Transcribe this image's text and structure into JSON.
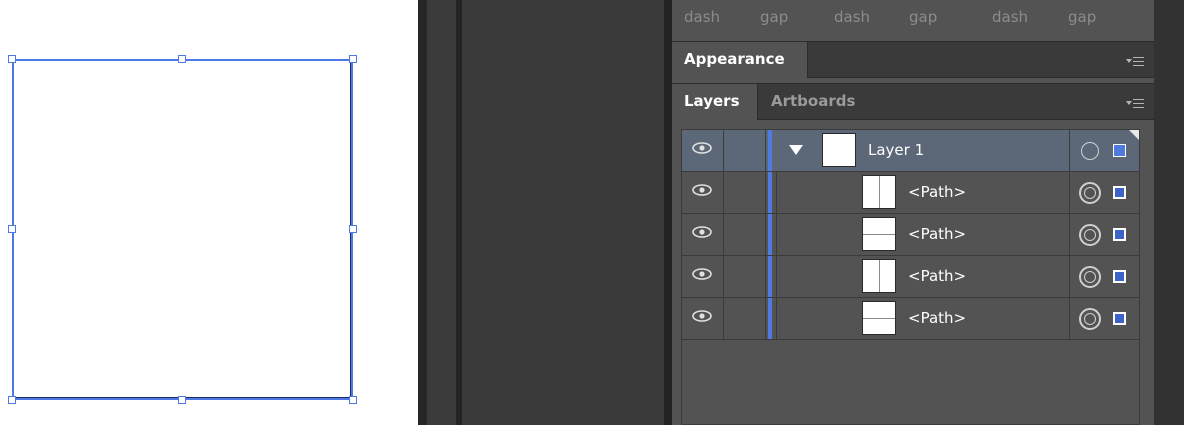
{
  "stroke_pattern": {
    "labels": [
      "dash",
      "gap",
      "dash",
      "gap",
      "dash",
      "gap"
    ]
  },
  "appearance_panel": {
    "tab_label": "Appearance",
    "menu_icon": "panel-menu-icon"
  },
  "layers_panel": {
    "tabs": [
      {
        "label": "Layers",
        "active": true
      },
      {
        "label": "Artboards",
        "active": false
      }
    ],
    "menu_icon": "panel-menu-icon",
    "layer": {
      "name": "Layer 1",
      "visible": true,
      "expanded": true,
      "color": "#4f7be0"
    },
    "items": [
      {
        "name": "<Path>",
        "thumbnail": "vertical-line",
        "visible": true,
        "selected": true
      },
      {
        "name": "<Path>",
        "thumbnail": "horizontal-line",
        "visible": true,
        "selected": true
      },
      {
        "name": "<Path>",
        "thumbnail": "vertical-line",
        "visible": true,
        "selected": true
      },
      {
        "name": "<Path>",
        "thumbnail": "horizontal-line",
        "visible": true,
        "selected": true
      }
    ]
  },
  "colors": {
    "selection": "#4d79e6",
    "layer_color": "#4f7be0",
    "panel_bg": "#535353",
    "tab_bar_bg": "#3a3a3a",
    "layer_row_highlight": "#5c6778"
  }
}
